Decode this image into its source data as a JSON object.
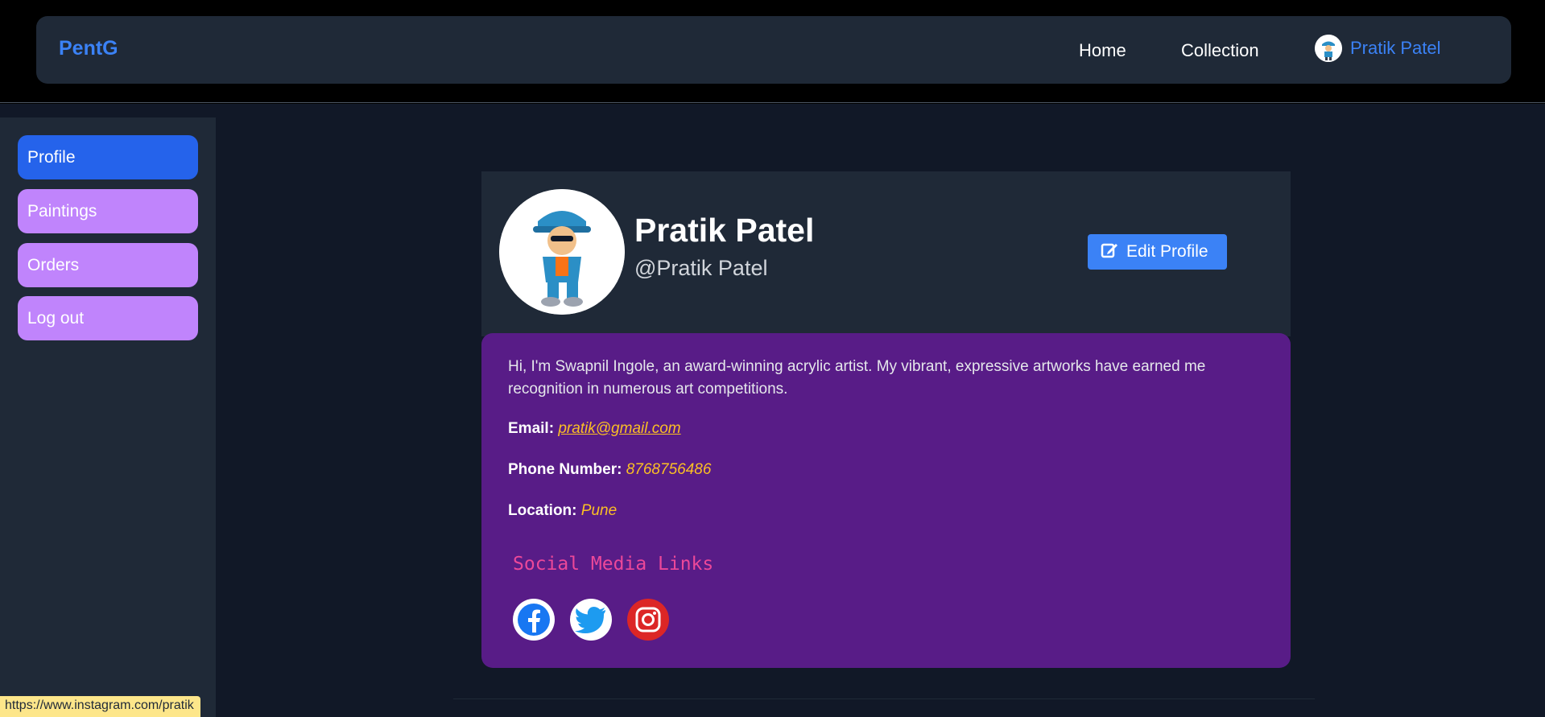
{
  "navbar": {
    "brand": "PentG",
    "links": [
      "Home",
      "Collection"
    ],
    "user_name": "Pratik Patel"
  },
  "sidebar": {
    "items": [
      {
        "label": "Profile",
        "active": true
      },
      {
        "label": "Paintings",
        "active": false
      },
      {
        "label": "Orders",
        "active": false
      },
      {
        "label": "Log out",
        "active": false
      }
    ]
  },
  "profile": {
    "name": "Pratik Patel",
    "handle": "@Pratik Patel",
    "edit_label": "Edit Profile",
    "bio": "Hi, I'm Swapnil Ingole, an award-winning acrylic artist. My vibrant, expressive artworks have earned me recognition in numerous art competitions.",
    "email_label": "Email:",
    "email": "pratik@gmail.com",
    "phone_label": "Phone Number:",
    "phone": "8768756486",
    "location_label": "Location:",
    "location": "Pune",
    "social_title": "Social Media Links",
    "social_icons": [
      "facebook-icon",
      "twitter-icon",
      "instagram-icon"
    ]
  },
  "status_bar": {
    "url": "https://www.instagram.com/pratik"
  },
  "colors": {
    "brand": "#3b82f6",
    "active_item": "#2563eb",
    "inactive_item": "#c084fc",
    "card_body": "#581c87",
    "accent_text": "#fbbf24",
    "social_title": "#ec4899"
  }
}
